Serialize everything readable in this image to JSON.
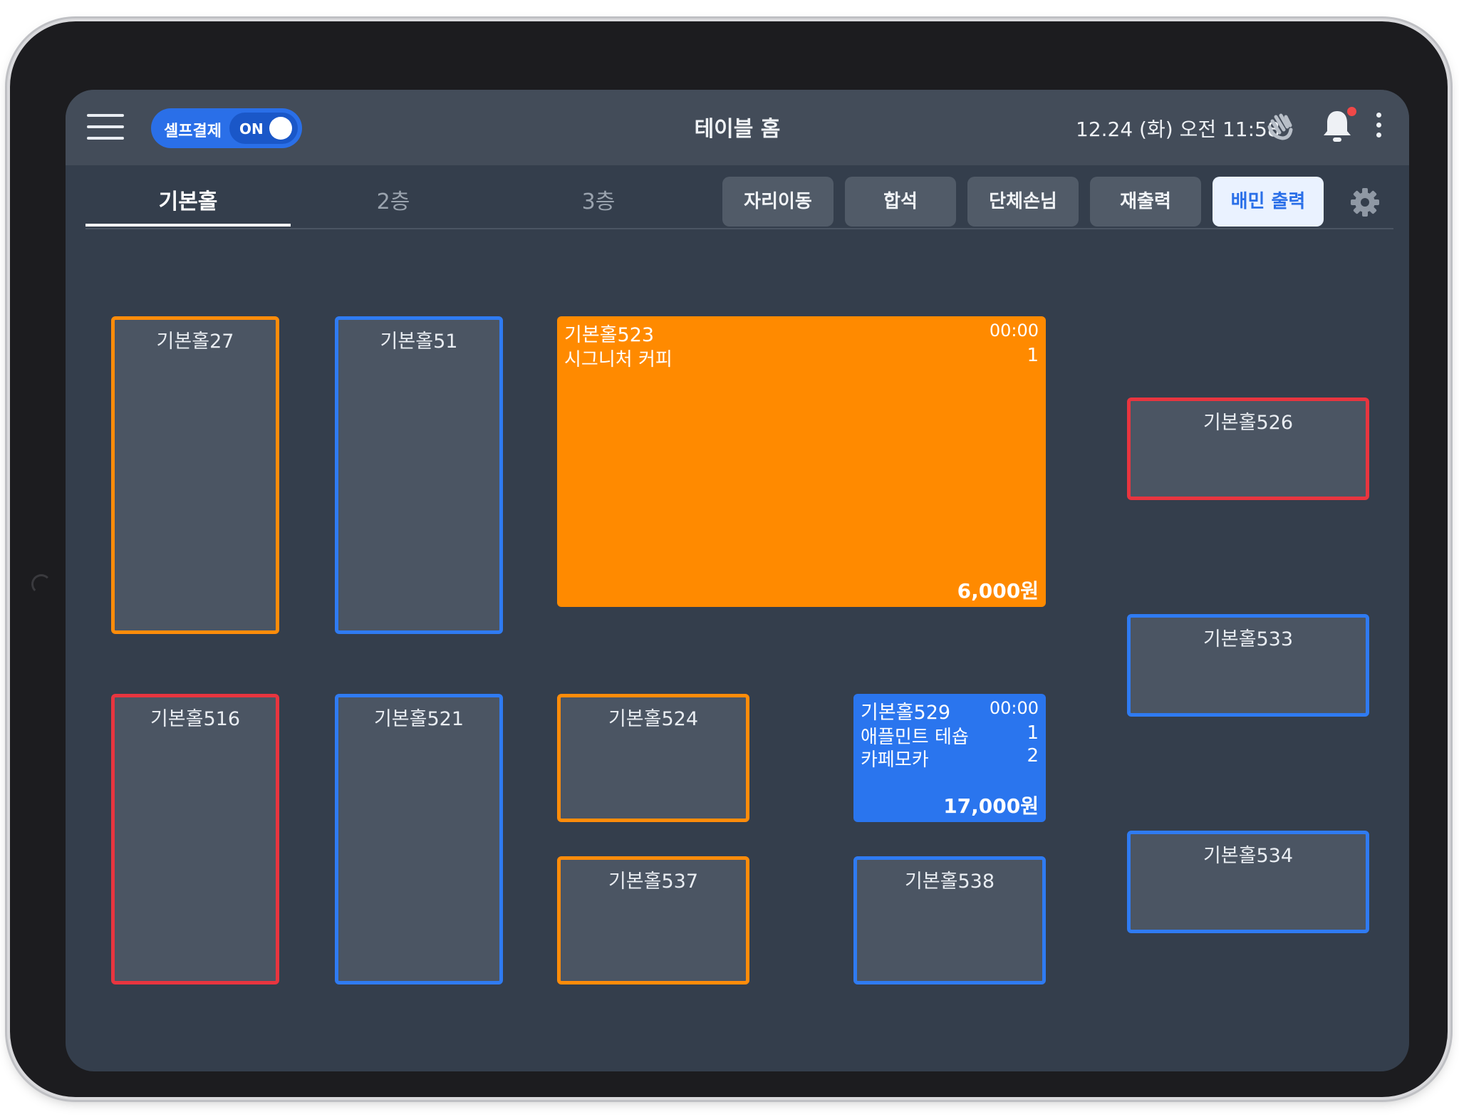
{
  "topbar": {
    "self_pay_label": "셀프결제",
    "self_pay_state": "ON",
    "title": "테이블 홈",
    "datetime": "12.24 (화) 오전 11:58",
    "icons": [
      "menu-icon",
      "hand-wave-icon",
      "bell-icon",
      "more-vertical-icon"
    ],
    "notification_dot_color": "#f04848"
  },
  "floors": [
    "기본홀",
    "2층",
    "3층"
  ],
  "active_floor": "기본홀",
  "actions": [
    "자리이동",
    "합석",
    "단체손님",
    "재출력",
    "배민 출력"
  ],
  "settings_icon": "gear-icon",
  "colors": {
    "accent": "#2a6fe8",
    "orange": "#ff8a00",
    "red": "#e8353f",
    "blue": "#2f7bf2"
  },
  "tables": {
    "t27": "기본홀27",
    "t51": "기본홀51",
    "t526": "기본홀526",
    "t533": "기본홀533",
    "t534": "기본홀534",
    "t516": "기본홀516",
    "t521": "기본홀521",
    "t524": "기본홀524",
    "t537": "기본홀537",
    "t538": "기본홀538"
  },
  "occupied": {
    "t523": {
      "name": "기본홀523",
      "time": "00:00",
      "items": [
        {
          "name": "시그니처 커피",
          "qty": "1"
        }
      ],
      "total": "6,000원"
    },
    "t529": {
      "name": "기본홀529",
      "time": "00:00",
      "items": [
        {
          "name": "애플민트 테숍",
          "qty": "1"
        },
        {
          "name": "카페모카",
          "qty": "2"
        }
      ],
      "total": "17,000원"
    }
  }
}
